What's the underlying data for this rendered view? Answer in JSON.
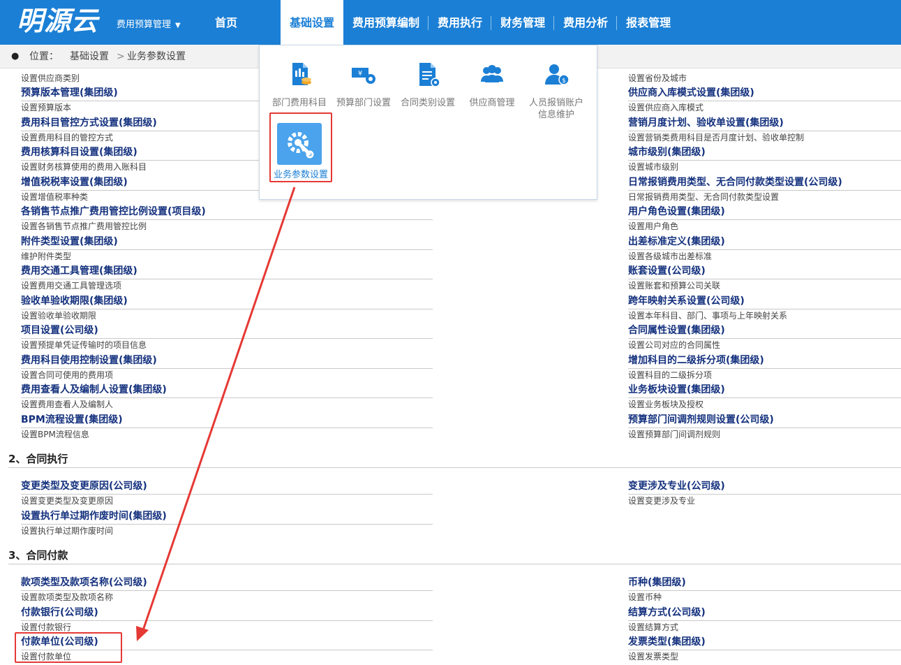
{
  "brand": {
    "logo": "明源云",
    "system_label": "费用预算管理",
    "accent": "#1b7fd5"
  },
  "nav": {
    "items": [
      "首页",
      "基础设置",
      "费用预算编制",
      "费用执行",
      "财务管理",
      "费用分析",
      "报表管理"
    ],
    "active": "基础设置"
  },
  "breadcrumb": {
    "prefix": "位置：",
    "parent": "基础设置",
    "current": "业务参数设置"
  },
  "dropdown": {
    "items": [
      {
        "label": "部门费用科目",
        "icon": "document-coins-icon"
      },
      {
        "label": "预算部门设置",
        "icon": "money-gear-icon"
      },
      {
        "label": "合同类别设置",
        "icon": "document-gear-icon"
      },
      {
        "label": "供应商管理",
        "icon": "people-group-icon"
      },
      {
        "label": "人员报销账户信息维护",
        "icon": "user-coin-icon"
      }
    ],
    "active_item": {
      "label": "业务参数设置",
      "icon": "gear-wrench-icon"
    }
  },
  "section1": {
    "left_top_desc": "设置供应商类别",
    "right_top_desc": "设置省份及城市",
    "left": [
      {
        "title": "预算版本管理(集团级)",
        "desc": "设置预算版本"
      },
      {
        "title": "费用科目管控方式设置(集团级)",
        "desc": "设置费用科目的管控方式"
      },
      {
        "title": "费用核算科目设置(集团级)",
        "desc": "设置财务核算使用的费用入账科目"
      },
      {
        "title": "增值税税率设置(集团级)",
        "desc": "设置增值税率种类"
      },
      {
        "title": "各销售节点推广费用管控比例设置(项目级)",
        "desc": "设置各销售节点推广费用管控比例"
      },
      {
        "title": "附件类型设置(集团级)",
        "desc": "维护附件类型"
      },
      {
        "title": "费用交通工具管理(集团级)",
        "desc": "设置费用交通工具管理选项"
      },
      {
        "title": "验收单验收期限(集团级)",
        "desc": "设置验收单验收期限"
      },
      {
        "title": "项目设置(公司级)",
        "desc": "设置预提单凭证传输时的项目信息"
      },
      {
        "title": "费用科目使用控制设置(集团级)",
        "desc": "设置合同可使用的费用项"
      },
      {
        "title": "费用查看人及编制人设置(集团级)",
        "desc": "设置费用查看人及编制人"
      },
      {
        "title": "BPM流程设置(集团级)",
        "desc": "设置BPM流程信息"
      }
    ],
    "right": [
      {
        "title": "供应商入库模式设置(集团级)",
        "desc": "设置供应商入库模式"
      },
      {
        "title": "营销月度计划、验收单设置(集团级)",
        "desc": "设置营销类费用科目是否月度计划、验收单控制"
      },
      {
        "title": "城市级别(集团级)",
        "desc": "设置城市级别"
      },
      {
        "title": "日常报销费用类型、无合同付款类型设置(公司级)",
        "desc": "日常报销费用类型、无合同付款类型设置"
      },
      {
        "title": "用户角色设置(集团级)",
        "desc": "设置用户角色"
      },
      {
        "title": "出差标准定义(集团级)",
        "desc": "设置各级城市出差标准"
      },
      {
        "title": "账套设置(公司级)",
        "desc": "设置账套和预算公司关联"
      },
      {
        "title": "跨年映射关系设置(公司级)",
        "desc": "设置本年科目、部门、事项与上年映射关系"
      },
      {
        "title": "合同属性设置(集团级)",
        "desc": "设置公司对应的合同属性"
      },
      {
        "title": "增加科目的二级拆分项(集团级)",
        "desc": "设置科目的二级拆分项"
      },
      {
        "title": "业务板块设置(集团级)",
        "desc": "设置业务板块及授权"
      },
      {
        "title": "预算部门间调剂规则设置(公司级)",
        "desc": "设置预算部门间调剂规则"
      }
    ]
  },
  "section2": {
    "title": "2、合同执行",
    "left": [
      {
        "title": "变更类型及变更原因(公司级)",
        "desc": "设置变更类型及变更原因"
      },
      {
        "title": "设置执行单过期作废时间(集团级)",
        "desc": "设置执行单过期作废时间"
      }
    ],
    "right": [
      {
        "title": "变更涉及专业(公司级)",
        "desc": "设置变更涉及专业"
      }
    ]
  },
  "section3": {
    "title": "3、合同付款",
    "left": [
      {
        "title": "款项类型及款项名称(公司级)",
        "desc": "设置款项类型及款项名称"
      },
      {
        "title": "付款银行(公司级)",
        "desc": "设置付款银行"
      },
      {
        "title": "付款单位(公司级)",
        "desc": "设置付款单位"
      }
    ],
    "right": [
      {
        "title": "币种(集团级)",
        "desc": "设置币种"
      },
      {
        "title": "结算方式(公司级)",
        "desc": "设置结算方式"
      },
      {
        "title": "发票类型(集团级)",
        "desc": "设置发票类型"
      }
    ]
  },
  "annotation_color": "#e53935"
}
